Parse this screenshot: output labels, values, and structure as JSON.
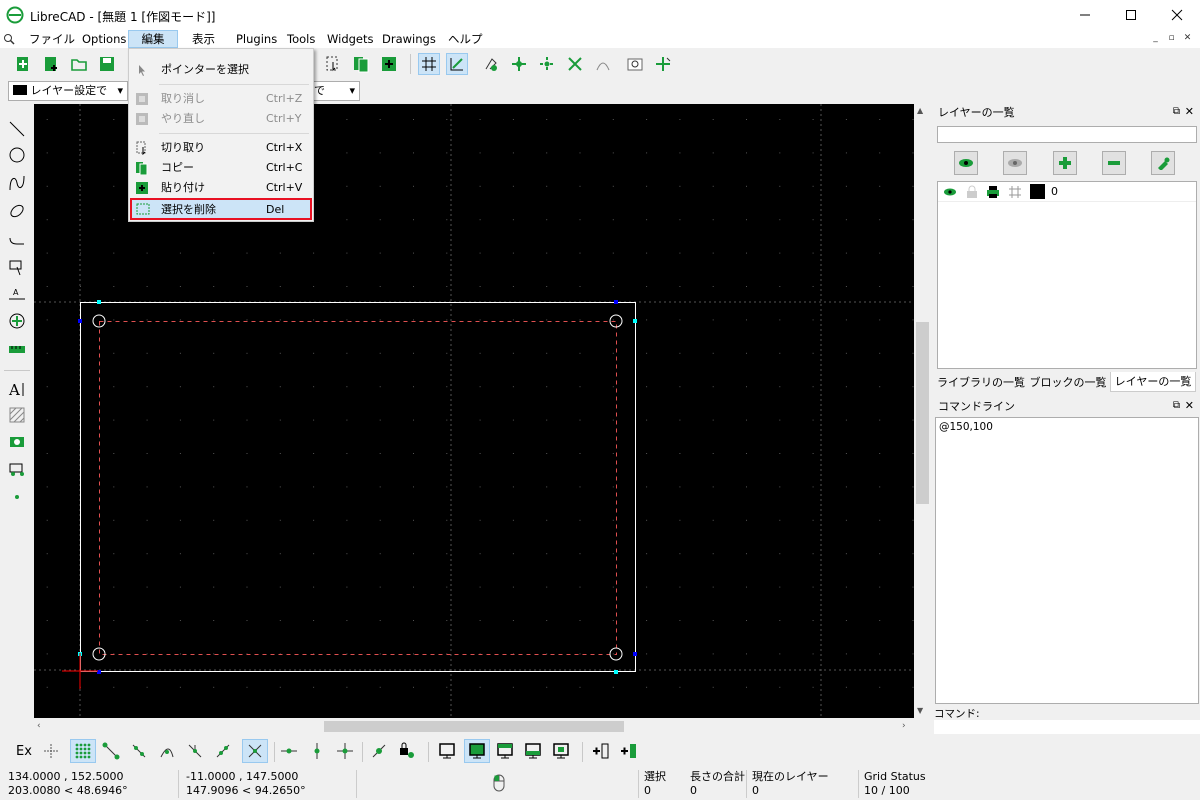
{
  "window": {
    "title": "LibreCAD - [無題 1 [作図モード]]",
    "minimize_icon": "minimize-icon",
    "maximize_icon": "maximize-icon",
    "close_icon": "close-icon"
  },
  "menubar": {
    "items": [
      "ファイル",
      "Options",
      "編集",
      "表示",
      "Plugins",
      "Tools",
      "Widgets",
      "Drawings",
      "ヘルプ"
    ],
    "active": "編集"
  },
  "edit_menu": {
    "items": [
      {
        "label": "ポインターを選択",
        "shortcut": "",
        "enabled": true,
        "icon": "pointer-icon"
      },
      {
        "label": "取り消し",
        "shortcut": "Ctrl+Z",
        "enabled": false,
        "icon": "undo-icon"
      },
      {
        "label": "やり直し",
        "shortcut": "Ctrl+Y",
        "enabled": false,
        "icon": "redo-icon"
      },
      {
        "label": "切り取り",
        "shortcut": "Ctrl+X",
        "enabled": true,
        "icon": "cut-icon"
      },
      {
        "label": "コピー",
        "shortcut": "Ctrl+C",
        "enabled": true,
        "icon": "copy-icon"
      },
      {
        "label": "貼り付け",
        "shortcut": "Ctrl+V",
        "enabled": true,
        "icon": "paste-icon"
      },
      {
        "label": "選択を削除",
        "shortcut": "Del",
        "enabled": true,
        "highlighted": true,
        "icon": "delete-selection-icon"
      }
    ]
  },
  "pen_toolbar": {
    "color_label": "レイヤー設定で",
    "width_label_tail": "で"
  },
  "layer_panel": {
    "title": "レイヤーの一覧",
    "filter_value": "",
    "layers": [
      {
        "name": "0",
        "color": "#000000"
      }
    ],
    "tabs": [
      "ライブラリの一覧",
      "ブロックの一覧",
      "レイヤーの一覧"
    ],
    "active_tab": "レイヤーの一覧"
  },
  "command_panel": {
    "title": "コマンドライン",
    "history": "@150,100",
    "prompt_label": "コマンド:"
  },
  "snap_toolbar": {
    "label": "Ex"
  },
  "status": {
    "abs_coord": "134.0000 , 152.5000",
    "abs_polar": "203.0080 < 48.6946°",
    "rel_coord": "-11.0000 , 147.5000",
    "rel_polar": "147.9096 < 94.2650°",
    "selected_label": "選択",
    "selected_value": "0",
    "total_length_label": "長さの合計",
    "total_length_value": "0",
    "current_layer_label": "現在のレイヤー",
    "current_layer_value": "0",
    "grid_status_label": "Grid Status",
    "grid_status_value": "10 / 100"
  },
  "colors": {
    "accent_selection": "#cce4f7",
    "highlight_border": "#e81123",
    "canvas_bg": "#000000",
    "icon_green": "#1a9c3a"
  }
}
